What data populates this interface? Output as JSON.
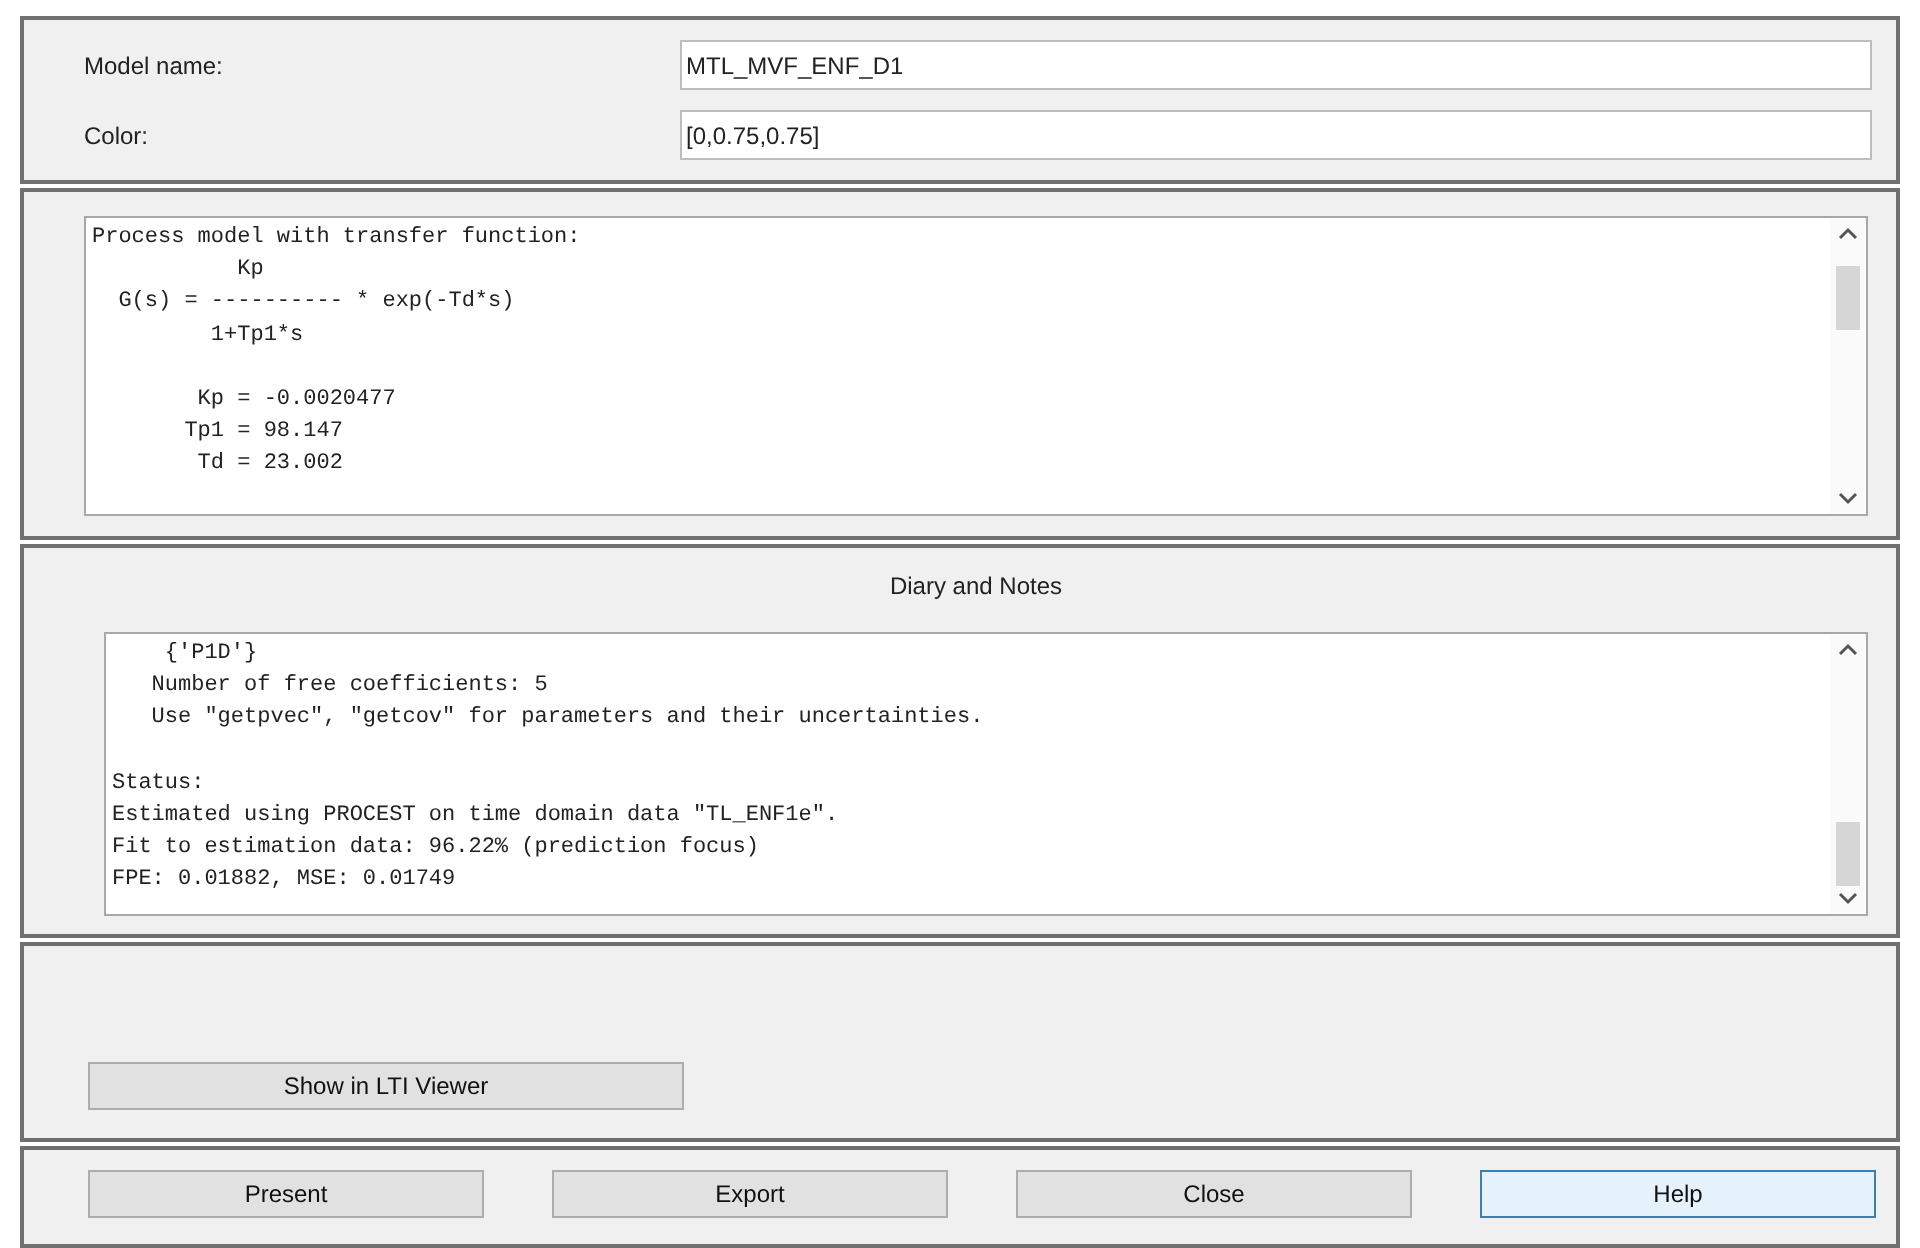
{
  "fields": [
    {
      "label": "Model name:",
      "value": "MTL_MVF_ENF_D1"
    },
    {
      "label": "Color:",
      "value": "[0,0.75,0.75]"
    }
  ],
  "model_text": {
    "blocks": [
      [
        "Process model with transfer function:",
        "           Kp",
        "  G(s) = ---------- * exp(-Td*s)",
        "         1+Tp1*s"
      ],
      [
        "        Kp = -0.0020477",
        "       Tp1 = 98.147",
        "        Td = 23.002"
      ]
    ]
  },
  "diary": {
    "title": "Diary and Notes",
    "blocks": [
      [
        "    {'P1D'}",
        "   Number of free coefficients: 5",
        "   Use \"getpvec\", \"getcov\" for parameters and their uncertainties."
      ],
      [
        "Status:",
        "Estimated using PROCEST on time domain data \"TL_ENF1e\".",
        "Fit to estimation data: 96.22% (prediction focus)",
        "FPE: 0.01882, MSE: 0.01749"
      ]
    ]
  },
  "lti_button": "Show in LTI Viewer",
  "buttons": [
    {
      "label": "Present",
      "focused": false
    },
    {
      "label": "Export",
      "focused": false
    },
    {
      "label": "Close",
      "focused": false
    },
    {
      "label": "Help",
      "focused": true
    }
  ]
}
